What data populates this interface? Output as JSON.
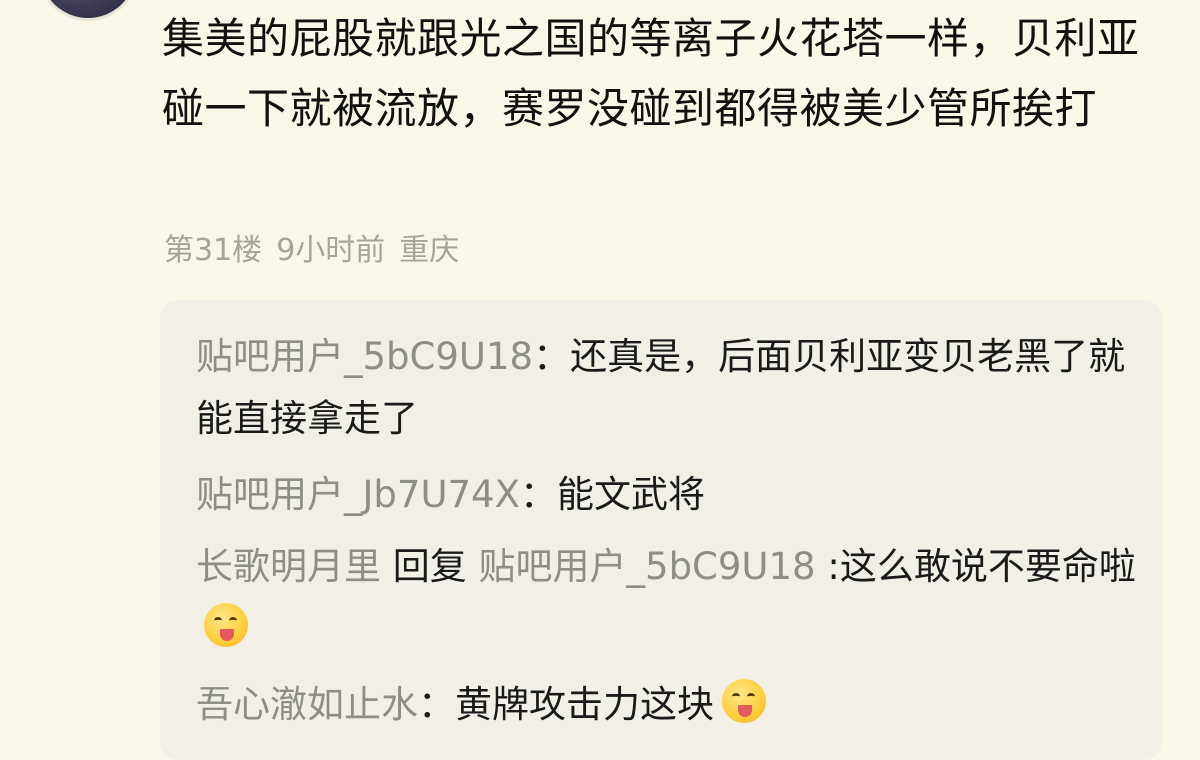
{
  "post": {
    "text": "集美的屁股就跟光之国的等离子火花塔一样，贝利亚碰一下就被流放，赛罗没碰到都得被美少管所挨打",
    "floor": "第31楼",
    "time": "9小时前",
    "location": "重庆"
  },
  "replies": [
    {
      "user": "贴吧用户_5bC9U18",
      "separator": "：",
      "text": "还真是，后面贝利亚变贝老黑了就能直接拿走了"
    },
    {
      "user": "贴吧用户_Jb7U74X",
      "separator": "：",
      "text": "能文武将"
    },
    {
      "user": "长歌明月里",
      "reply_word": "回复",
      "reply_to": "贴吧用户_5bC9U18",
      "separator": " :",
      "text": "这么敢说不要命啦",
      "emoji": "yum-face-emoji"
    },
    {
      "user": "吾心澈如止水",
      "separator": "：",
      "text": "黄牌攻击力这块",
      "emoji": "yum-face-emoji"
    }
  ]
}
